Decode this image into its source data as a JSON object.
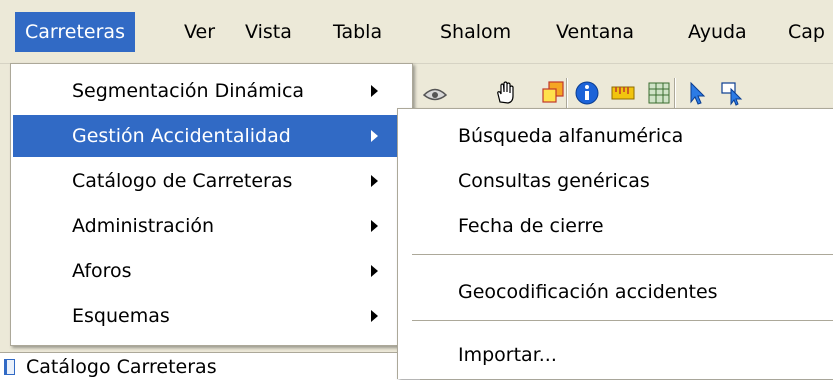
{
  "menubar": {
    "items": [
      {
        "label": "Carreteras",
        "active": true
      },
      {
        "label": "Ver"
      },
      {
        "label": "Vista"
      },
      {
        "label": "Tabla"
      },
      {
        "label": "Shalom"
      },
      {
        "label": "Ventana"
      },
      {
        "label": "Ayuda"
      },
      {
        "label": "Cap"
      }
    ]
  },
  "toolbar": {
    "icons": [
      "eye-icon",
      "pan-hand-icon",
      "select-layers-icon",
      "info-icon",
      "measure-icon",
      "table-icon",
      "pointer-arrow-icon",
      "select-arrow-icon"
    ]
  },
  "main_menu": {
    "items": [
      {
        "label": "Segmentación Dinámica",
        "submenu": true
      },
      {
        "label": "Gestión Accidentalidad",
        "submenu": true,
        "highlighted": true
      },
      {
        "label": "Catálogo de Carreteras",
        "submenu": true
      },
      {
        "label": "Administración",
        "submenu": true
      },
      {
        "label": "Aforos",
        "submenu": true
      },
      {
        "label": "Esquemas",
        "submenu": true
      }
    ]
  },
  "sub_menu": {
    "items": [
      {
        "label": "Búsqueda alfanumérica"
      },
      {
        "label": "Consultas genéricas"
      },
      {
        "label": "Fecha de cierre"
      },
      {
        "label": "Geocodificación accidentes"
      },
      {
        "label": "Importar..."
      }
    ]
  },
  "panel": {
    "tab_label": "Catálogo Carreteras"
  },
  "colors": {
    "highlight": "#316ac5",
    "menubar_bg": "#ece9d8",
    "menu_bg": "#ffffff"
  }
}
